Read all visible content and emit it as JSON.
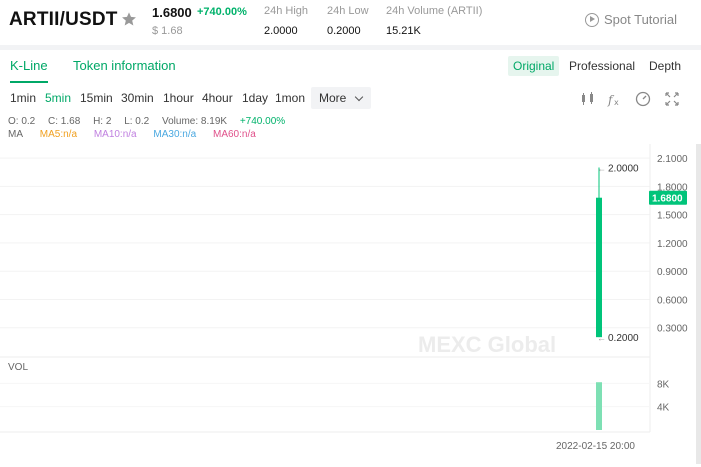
{
  "header": {
    "pair": "ARTII/USDT",
    "price": "1.6800",
    "change": "+740.00%",
    "usd_price": "$ 1.68",
    "stats": [
      {
        "label": "24h High",
        "value": "2.0000"
      },
      {
        "label": "24h Low",
        "value": "0.2000"
      },
      {
        "label": "24h Volume (ARTII)",
        "value": "15.21K"
      }
    ],
    "spot_tutorial": "Spot Tutorial"
  },
  "tabs": {
    "kline": "K-Line",
    "token_info": "Token information",
    "views": [
      "Original",
      "Professional",
      "Depth"
    ],
    "active_view": "Original"
  },
  "toolbar": {
    "intervals": [
      "1min",
      "5min",
      "15min",
      "30min",
      "1hour",
      "4hour",
      "1day",
      "1mon"
    ],
    "active_interval": "5min",
    "more": "More"
  },
  "ohlc": {
    "open": "O: 0.2",
    "close": "C: 1.68",
    "high": "H: 2",
    "low": "L: 0.2",
    "volume": "Volume: 8.19K",
    "change": "+740.00%"
  },
  "ma": {
    "label": "MA",
    "ma5": "MA5:n/a",
    "ma10": "MA10:n/a",
    "ma30": "MA30:n/a",
    "ma60": "MA60:n/a",
    "colors": {
      "ma5": "#f0a020",
      "ma10": "#c080e0",
      "ma30": "#4aa8e0",
      "ma60": "#e0508a"
    }
  },
  "chart_data": {
    "type": "candlestick",
    "price_axis_ticks": [
      "2.1000",
      "1.8000",
      "1.5000",
      "1.2000",
      "0.9000",
      "0.6000",
      "0.3000"
    ],
    "price_ylim": [
      0.0,
      2.25
    ],
    "current_price_tag": "1.6800",
    "high_label": "2.0000",
    "low_label": "0.2000",
    "candles": [
      {
        "time": "2022-02-15 20:00",
        "open": 0.2,
        "high": 2.0,
        "low": 0.2,
        "close": 1.68,
        "volume": 8190
      }
    ],
    "volume_label": "VOL",
    "volume_axis_ticks": [
      "8K",
      "4K"
    ],
    "volume_ylim": [
      0,
      12000
    ],
    "timestamp": "2022-02-15 20:00",
    "up_color": "#00c47a",
    "watermark": "MEXC Global"
  }
}
